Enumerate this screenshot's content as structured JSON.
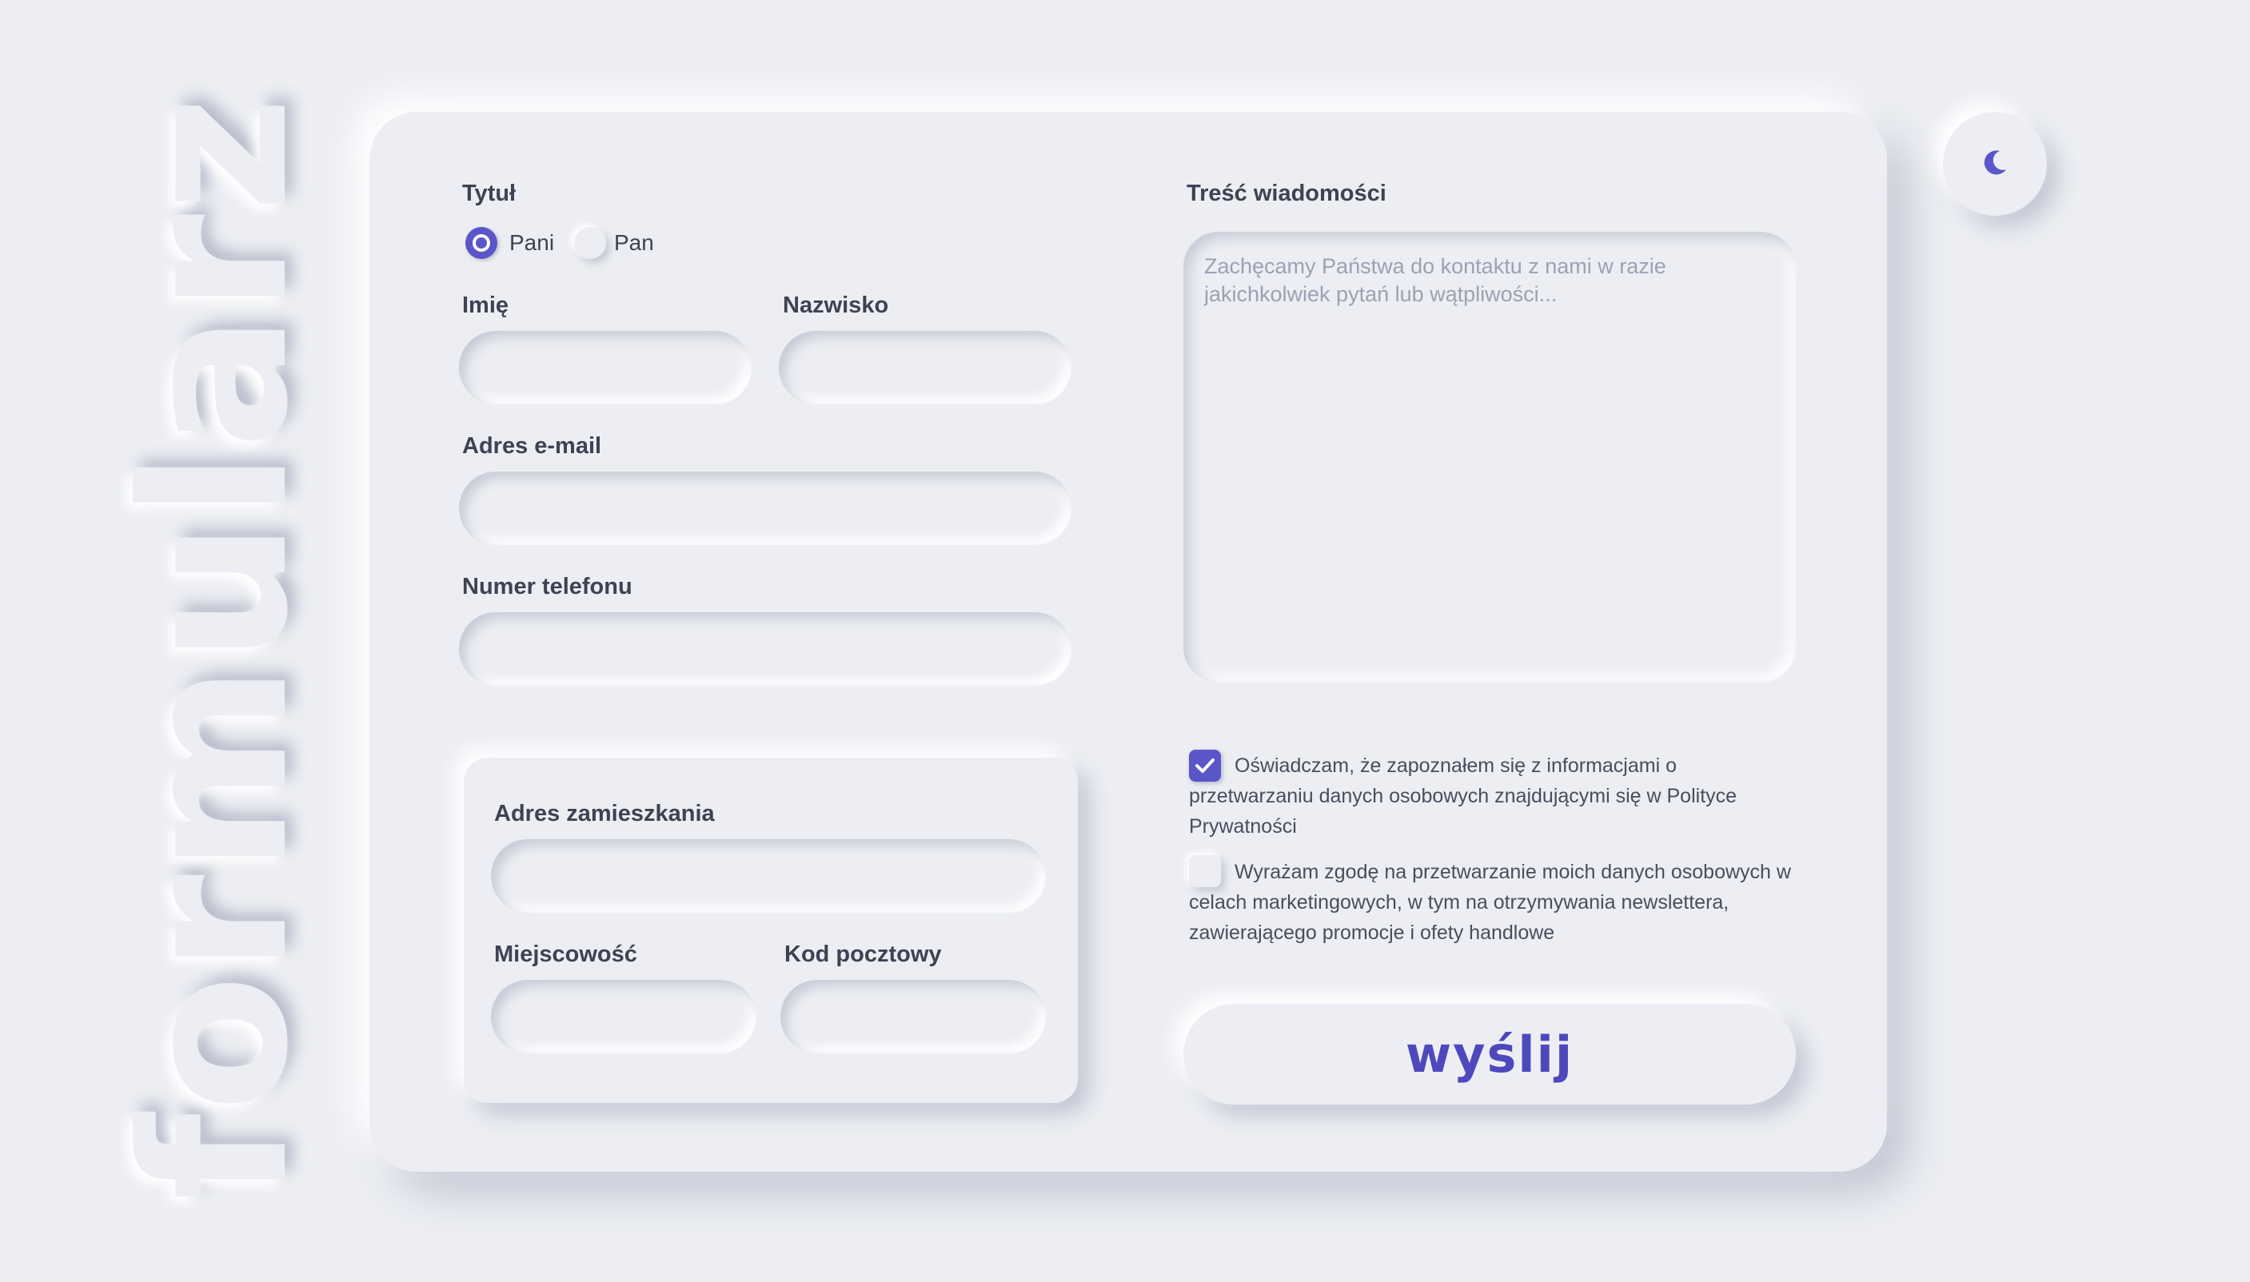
{
  "side_title": "formularz",
  "theme_toggle": {
    "icon": "moon-icon"
  },
  "form": {
    "title_label": "Tytuł",
    "title_options": [
      {
        "label": "Pani",
        "selected": true
      },
      {
        "label": "Pan",
        "selected": false
      }
    ],
    "first_name_label": "Imię",
    "last_name_label": "Nazwisko",
    "email_label": "Adres e-mail",
    "phone_label": "Numer telefonu",
    "address": {
      "street_label": "Adres zamieszkania",
      "city_label": "Miejscowość",
      "postal_label": "Kod pocztowy"
    },
    "message_label": "Treść wiadomości",
    "message_placeholder": "Zachęcamy Państwa do kontaktu z nami w razie jakichkolwiek pytań lub wątpliwości...",
    "consents": [
      {
        "checked": true,
        "text": "Oświadczam, że zapoznałem się z informacjami o przetwarzaniu danych osobowych znajdującymi się w Polityce Prywatności"
      },
      {
        "checked": false,
        "text": "Wyrażam zgodę na przetwarzanie moich danych osobowych w celach marketingowych, w tym na otrzymywania newslettera, zawierającego promocje i ofety handlowe"
      }
    ],
    "submit_label": "wyślij"
  },
  "colors": {
    "background": "#eceef3",
    "accent": "#5a56c8",
    "text": "#3f4253"
  }
}
